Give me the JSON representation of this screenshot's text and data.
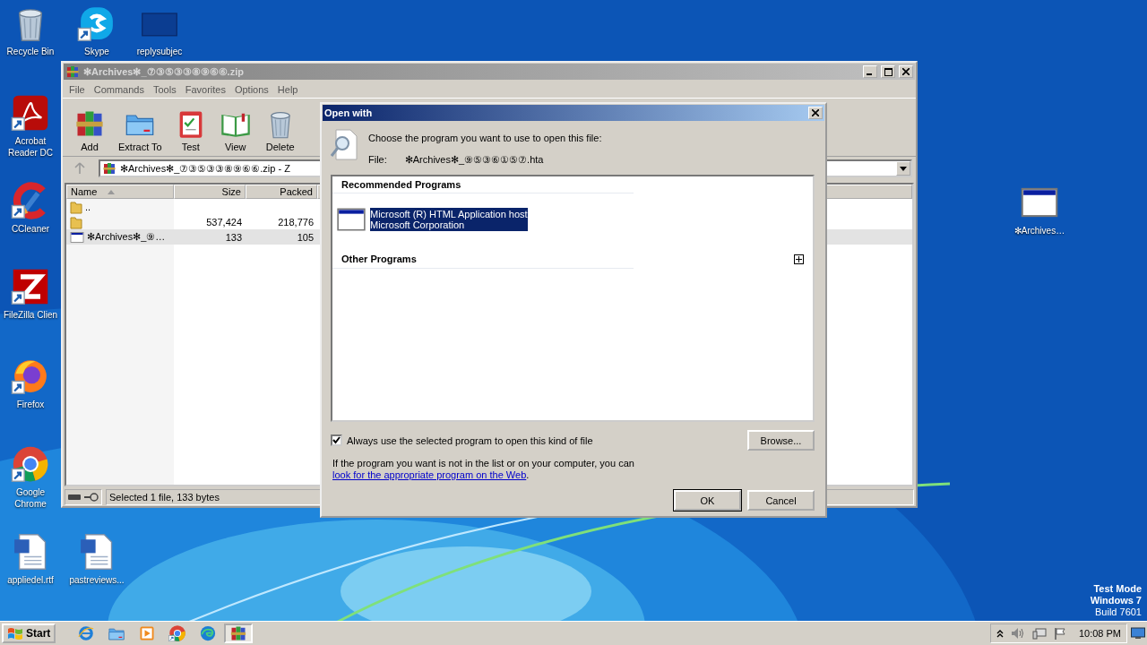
{
  "desktop": {
    "icons": [
      {
        "label": "Recycle Bin",
        "kind": "recycle"
      },
      {
        "label": "Skype",
        "kind": "skype"
      },
      {
        "label": "replysubjec",
        "kind": "blank"
      },
      {
        "label": "Acrobat Reader DC",
        "kind": "acrobat"
      },
      {
        "label": "CCleaner",
        "kind": "ccleaner"
      },
      {
        "label": "FileZilla Clien",
        "kind": "filezilla"
      },
      {
        "label": "Firefox",
        "kind": "firefox"
      },
      {
        "label": "Google Chrome",
        "kind": "chrome"
      },
      {
        "label": "appliedel.rtf",
        "kind": "word"
      },
      {
        "label": "pastreviews...",
        "kind": "word"
      },
      {
        "label": "✻Archives…",
        "kind": "hta"
      }
    ],
    "os_notice": [
      "Test Mode",
      "Windows 7",
      "Build 7601"
    ]
  },
  "archiver": {
    "title": "✻Archives✻_⑦③⑤③③⑧⑨⑥⑥.zip",
    "menu": [
      "File",
      "Commands",
      "Tools",
      "Favorites",
      "Options",
      "Help"
    ],
    "toolbar": [
      {
        "label": "Add",
        "kind": "books"
      },
      {
        "label": "Extract To",
        "kind": "folder"
      },
      {
        "label": "Test",
        "kind": "clipboard"
      },
      {
        "label": "View",
        "kind": "book"
      },
      {
        "label": "Delete",
        "kind": "trash"
      }
    ],
    "address": "✻Archives✻_⑦③⑤③③⑧⑨⑥⑥.zip - Z",
    "columns": [
      "Name",
      "Size",
      "Packed"
    ],
    "rows": [
      {
        "kind": "up",
        "name": "..",
        "selected": false
      },
      {
        "kind": "folder",
        "size": "537,424",
        "packed": "218,776",
        "selected": false
      },
      {
        "kind": "file",
        "name": "✻Archives✻_⑨…",
        "size": "133",
        "packed": "105",
        "selected": true
      }
    ],
    "status": "Selected 1 file, 133 bytes"
  },
  "dialog": {
    "title": "Open with",
    "prompt": "Choose the program you want to use to open this file:",
    "file_label": "File:",
    "file_name": "✻Archives✻_⑨⑤③⑥①⑤⑦.hta",
    "recommended": {
      "heading": "Recommended Programs",
      "programs": [
        {
          "name": "Microsoft (R) HTML Application host",
          "publisher": "Microsoft Corporation",
          "selected": true
        }
      ]
    },
    "other": {
      "heading": "Other Programs",
      "expanded": false
    },
    "always_use": {
      "label": "Always use the selected program to open this kind of file",
      "checked": true
    },
    "browse": "Browse...",
    "info": {
      "text": "If the program you want is not in the list or on your computer, you can ",
      "link": "look for the appropriate program on the Web",
      "end": "."
    },
    "buttons": [
      "OK",
      "Cancel"
    ]
  },
  "taskbar": {
    "start": "Start",
    "apps": [
      {
        "kind": "ie",
        "selected": false
      },
      {
        "kind": "explorer",
        "selected": false
      },
      {
        "kind": "media",
        "selected": false
      },
      {
        "kind": "chrome",
        "selected": false
      },
      {
        "kind": "edge",
        "selected": false
      },
      {
        "kind": "books",
        "selected": true
      }
    ],
    "clock": "10:08 PM"
  }
}
